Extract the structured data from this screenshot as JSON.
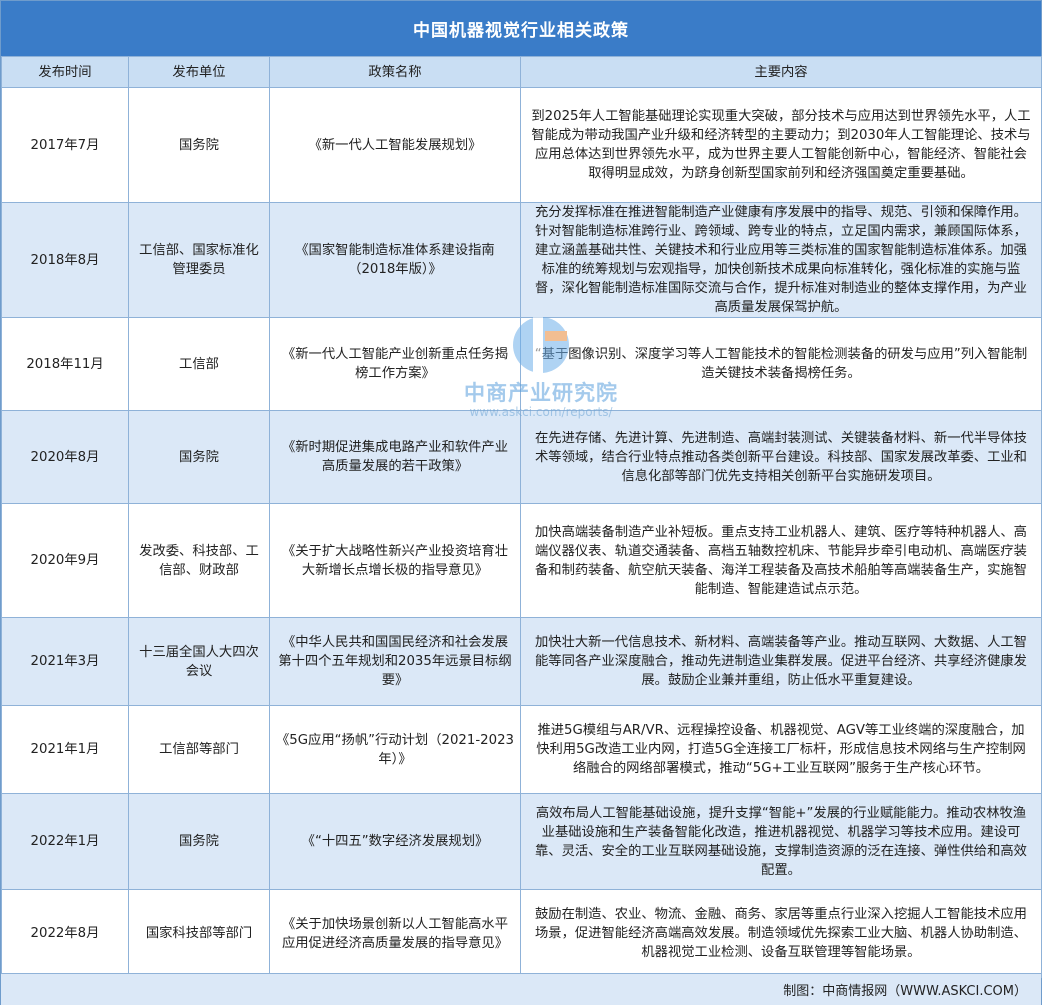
{
  "title": "中国机器视觉行业相关政策",
  "headers": [
    "发布时间",
    "发布单位",
    "政策名称",
    "主要内容"
  ],
  "rows": [
    {
      "date": "2017年7月",
      "org": "国务院",
      "policy": "《新一代人工智能发展规划》",
      "content": "到2025年人工智能基础理论实现重大突破，部分技术与应用达到世界领先水平，人工智能成为带动我国产业升级和经济转型的主要动力；到2030年人工智能理论、技术与应用总体达到世界领先水平，成为世界主要人工智能创新中心，智能经济、智能社会取得明显成效，为跻身创新型国家前列和经济强国奠定重要基础。"
    },
    {
      "date": "2018年8月",
      "org": "工信部、国家标准化管理委员",
      "policy": "《国家智能制造标准体系建设指南（2018年版）》",
      "content": "充分发挥标准在推进智能制造产业健康有序发展中的指导、规范、引领和保障作用。针对智能制造标准跨行业、跨领域、跨专业的特点，立足国内需求，兼顾国际体系，建立涵盖基础共性、关键技术和行业应用等三类标准的国家智能制造标准体系。加强标准的统筹规划与宏观指导，加快创新技术成果向标准转化，强化标准的实施与监督，深化智能制造标准国际交流与合作，提升标准对制造业的整体支撑作用，为产业高质量发展保驾护航。"
    },
    {
      "date": "2018年11月",
      "org": "工信部",
      "policy": "《新一代人工智能产业创新重点任务揭榜工作方案》",
      "content": "“基于图像识别、深度学习等人工智能技术的智能检测装备的研发与应用”列入智能制造关键技术装备揭榜任务。"
    },
    {
      "date": "2020年8月",
      "org": "国务院",
      "policy": "《新时期促进集成电路产业和软件产业高质量发展的若干政策》",
      "content": "在先进存储、先进计算、先进制造、高端封装测试、关键装备材料、新一代半导体技术等领域，结合行业特点推动各类创新平台建设。科技部、国家发展改革委、工业和信息化部等部门优先支持相关创新平台实施研发项目。"
    },
    {
      "date": "2020年9月",
      "org": "发改委、科技部、工信部、财政部",
      "policy": "《关于扩大战略性新兴产业投资培育壮大新增长点增长极的指导意见》",
      "content": "加快高端装备制造产业补短板。重点支持工业机器人、建筑、医疗等特种机器人、高端仪器仪表、轨道交通装备、高档五轴数控机床、节能异步牵引电动机、高端医疗装备和制药装备、航空航天装备、海洋工程装备及高技术船舶等高端装备生产，实施智能制造、智能建造试点示范。"
    },
    {
      "date": "2021年3月",
      "org": "十三届全国人大四次会议",
      "policy": "《中华人民共和国国民经济和社会发展第十四个五年规划和2035年远景目标纲要》",
      "content": "加快壮大新一代信息技术、新材料、高端装备等产业。推动互联网、大数据、人工智能等同各产业深度融合，推动先进制造业集群发展。促进平台经济、共享经济健康发展。鼓励企业兼并重组，防止低水平重复建设。"
    },
    {
      "date": "2021年1月",
      "org": "工信部等部门",
      "policy": "《5G应用“扬帆”行动计划（2021-2023年）》",
      "content": "推进5G模组与AR/VR、远程操控设备、机器视觉、AGV等工业终端的深度融合，加快利用5G改造工业内网，打造5G全连接工厂标杆，形成信息技术网络与生产控制网络融合的网络部署模式，推动“5G+工业互联网”服务于生产核心环节。"
    },
    {
      "date": "2022年1月",
      "org": "国务院",
      "policy": "《“十四五”数字经济发展规划》",
      "content": "高效布局人工智能基础设施，提升支撑“智能+”发展的行业赋能能力。推动农林牧渔业基础设施和生产装备智能化改造，推进机器视觉、机器学习等技术应用。建设可靠、灵活、安全的工业互联网基础设施，支撑制造资源的泛在连接、弹性供给和高效配置。"
    },
    {
      "date": "2022年8月",
      "org": "国家科技部等部门",
      "policy": "《关于加快场景创新以人工智能高水平应用促进经济高质量发展的指导意见》",
      "content": "鼓励在制造、农业、物流、金融、商务、家居等重点行业深入挖掘人工智能技术应用场景，促进智能经济高端高效发展。制造领域优先探索工业大脑、机器人协助制造、机器视觉工业检测、设备互联管理等智能场景。"
    }
  ],
  "footer": "制图：中商情报网（WWW.ASKCI.COM）",
  "watermark": {
    "name": "中商产业研究院",
    "url": "www.askci.com/reports/"
  },
  "colors": {
    "title_bg": "#3a7cc8",
    "header_bg": "#c9def3",
    "alt_row_bg": "#dbe8f7",
    "border": "#8fb2d8"
  }
}
